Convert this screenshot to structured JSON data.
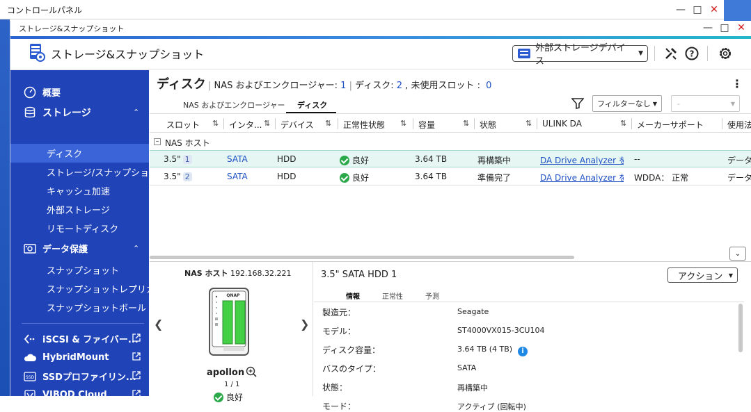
{
  "control_panel": {
    "title": "コントロールパネル"
  },
  "window": {
    "title": "ストレージ&スナップショット"
  },
  "header": {
    "app_name": "ストレージ&スナップショット",
    "device_select": "外部ストレージデバイス"
  },
  "sidebar": {
    "overview": "概要",
    "storage": "ストレージ",
    "storage_items": [
      "ディスク",
      "ストレージ/スナップショ...",
      "キャッシュ加速",
      "外部ストレージ",
      "リモートディスク"
    ],
    "data_protection": "データ保護",
    "protection_items": [
      "スナップショット",
      "スナップショットレプリカ",
      "スナップショットボールト"
    ],
    "apps": [
      "iSCSI & ファイバー...",
      "HybridMount",
      "SSDプロファイリン...",
      "VJBOD Cloud"
    ]
  },
  "page": {
    "title": "ディスク",
    "enclosure_label": "NAS およびエンクロージャー:",
    "enclosure_count": "1",
    "disk_label": "ディスク:",
    "disk_count": "2",
    "slot_label": "未使用スロット :",
    "slot_count": "0"
  },
  "tabs": [
    "NAS およびエンクロージャー",
    "ディスク"
  ],
  "filter": {
    "value": "フィルターなし",
    "secondary": "-"
  },
  "table": {
    "columns": [
      "スロット",
      "インタ...",
      "デバイス",
      "正常性状態",
      "容量",
      "状態",
      "ULINK DA",
      "メーカーサポート",
      "使用法"
    ],
    "group": "NAS ホスト",
    "rows": [
      {
        "slot": "3.5\"",
        "slot_num": "1",
        "interface": "SATA",
        "device": "HDD",
        "health": "良好",
        "capacity": "3.64 TB",
        "status": "再構築中",
        "ulink": "DA Drive Analyzer を...",
        "support": "--",
        "usage": "データ"
      },
      {
        "slot": "3.5\"",
        "slot_num": "2",
        "interface": "SATA",
        "device": "HDD",
        "health": "良好",
        "capacity": "3.64 TB",
        "status": "準備完了",
        "ulink": "DA Drive Analyzer を...",
        "support": "WDDA： 正常",
        "usage": "データ"
      }
    ]
  },
  "nas": {
    "host_label": "NAS ホスト",
    "host_ip": "192.168.32.221",
    "name": "apollon",
    "page": "1 / 1",
    "status": "良好",
    "logo": "QNAP"
  },
  "disk": {
    "title": "3.5\" SATA HDD 1",
    "action": "アクション",
    "tabs": [
      "情報",
      "正常性",
      "予測"
    ],
    "props": [
      {
        "label": "製造元：",
        "value": "Seagate"
      },
      {
        "label": "モデル：",
        "value": "ST4000VX015-3CU104"
      },
      {
        "label": "ディスク容量：",
        "value": "3.64 TB (4 TB)"
      },
      {
        "label": "バスのタイプ：",
        "value": "SATA"
      },
      {
        "label": "状態：",
        "value": "再構築中"
      },
      {
        "label": "モード：",
        "value": "アクティブ (回転中)"
      }
    ]
  },
  "colors": {
    "sidebar": "#2044b8",
    "accent": "#1f51c4",
    "ok": "#2aa84a",
    "selected_row": "#e6f6f3"
  }
}
